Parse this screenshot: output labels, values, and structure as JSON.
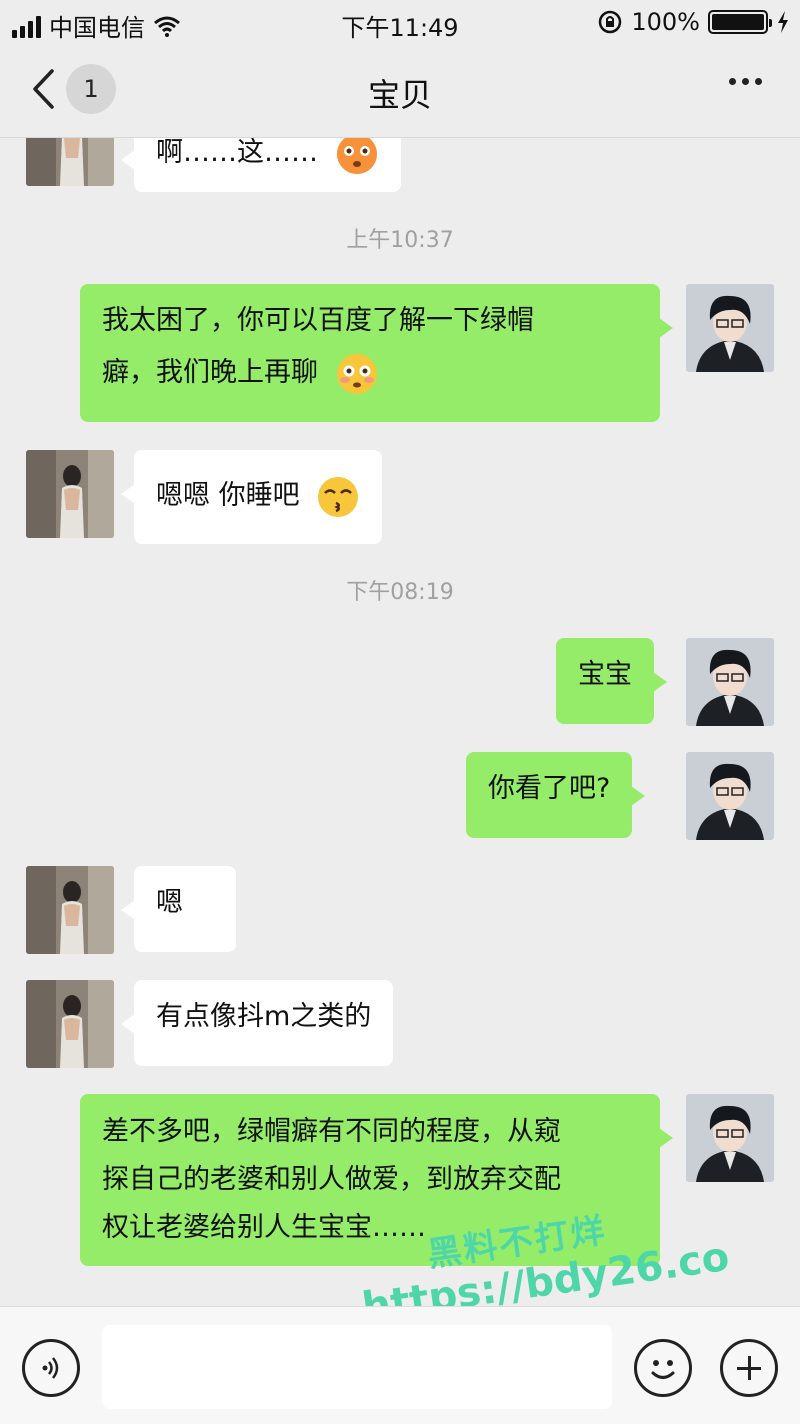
{
  "status_bar": {
    "carrier": "中国电信",
    "time": "下午11:49",
    "battery": "100%",
    "battery_level": 1.0
  },
  "header": {
    "back_label": "<",
    "unread_count": "1",
    "title": "宝贝",
    "more_label": "•••"
  },
  "messages": [
    {
      "side": "in",
      "text": "啊……这……",
      "emoji": "flushed-face"
    },
    {
      "type": "time",
      "text": "上午10:37"
    },
    {
      "side": "out",
      "text_lines": [
        "我太困了，你可以百度了解一下绿帽",
        "癖，我们晚上再聊"
      ],
      "emoji": "flushed-face"
    },
    {
      "side": "in",
      "text": "嗯嗯 你睡吧",
      "emoji": "kissing-face"
    },
    {
      "type": "time",
      "text": "下午08:19"
    },
    {
      "side": "out",
      "text": "宝宝"
    },
    {
      "side": "out",
      "text": "你看了吧?"
    },
    {
      "side": "in",
      "text": "嗯"
    },
    {
      "side": "in",
      "text": "有点像抖m之类的"
    },
    {
      "side": "out",
      "text_lines": [
        "差不多吧，绿帽癖有不同的程度，从窥",
        "探自己的老婆和别人做爱，到放弃交配",
        "权让老婆给别人生宝宝……"
      ]
    }
  ],
  "watermark": {
    "line1": "黑料不打烊",
    "line2": "https://bdy26.co"
  },
  "colors": {
    "background": "#ededed",
    "outgoing_bubble": "#95ec69",
    "incoming_bubble": "#ffffff",
    "watermark": "#4fd6a8"
  },
  "icons": [
    "voice-icon",
    "emoji-icon",
    "plus-icon",
    "back-chevron-icon",
    "more-icon",
    "wifi-icon",
    "lock-rotation-icon",
    "charging-icon"
  ]
}
